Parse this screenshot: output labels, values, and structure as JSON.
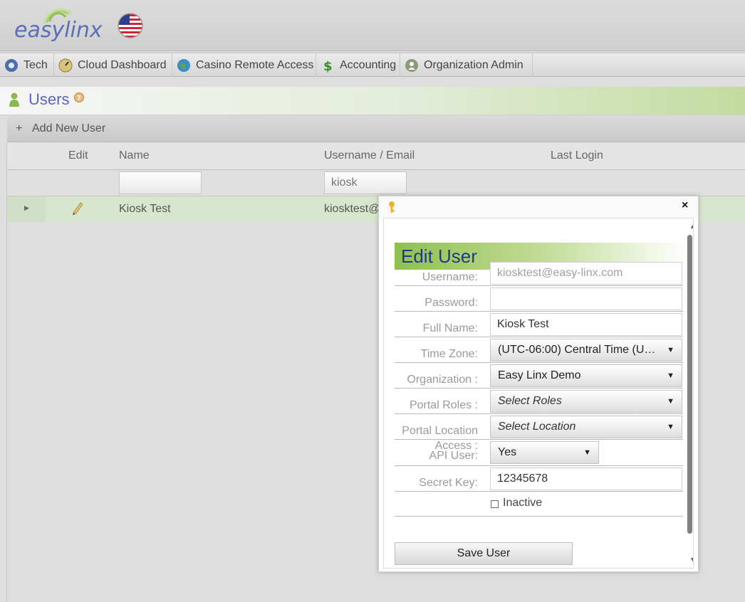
{
  "brand": {
    "logo_text": "easylinx",
    "logo_color": "#5a6fb8",
    "accent_green": "#8fbf4d"
  },
  "nav": {
    "items": [
      {
        "label": "Tech",
        "icon": "tech-gear-icon"
      },
      {
        "label": "Cloud Dashboard",
        "icon": "speedometer-icon"
      },
      {
        "label": "Casino Remote Access",
        "icon": "globe-icon"
      },
      {
        "label": "Accounting",
        "icon": "dollar-icon"
      },
      {
        "label": "Organization Admin",
        "icon": "org-admin-icon"
      }
    ]
  },
  "users_panel": {
    "title": "Users",
    "add_label": "Add New User",
    "columns": {
      "edit": "Edit",
      "name": "Name",
      "username_email": "Username / Email",
      "last_login": "Last Login"
    },
    "filters": {
      "name": "",
      "username": "kiosk"
    },
    "rows": [
      {
        "name": "Kiosk Test",
        "username": "kiosktest@"
      }
    ]
  },
  "modal": {
    "title": "Edit User",
    "labels": {
      "username": "Username:",
      "password": "Password:",
      "full_name": "Full Name:",
      "time_zone": "Time Zone:",
      "organization": "Organization :",
      "portal_roles": "Portal Roles :",
      "portal_location": "Portal Location",
      "access_line1": "Access :",
      "access_line2": "API User:",
      "secret_key": "Secret Key:"
    },
    "values": {
      "username": "kiosktest@easy-linx.com",
      "password": "",
      "full_name": "Kiosk Test",
      "time_zone": "(UTC-06:00) Central Time (US ...",
      "organization": "Easy Linx Demo",
      "portal_roles": "Select Roles",
      "portal_location": "Select Location",
      "api_user": "Yes",
      "secret_key": "12345678"
    },
    "inactive_label": "Inactive",
    "inactive_checked": false,
    "save_label": "Save User",
    "close_glyph": "×"
  }
}
